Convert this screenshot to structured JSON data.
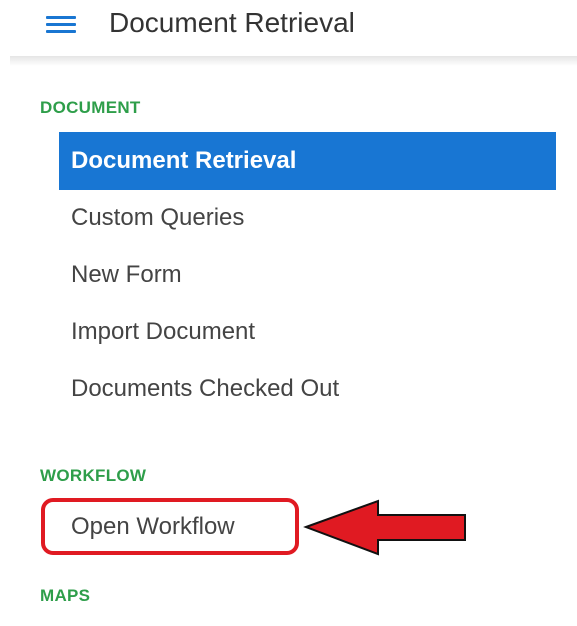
{
  "header": {
    "title": "Document Retrieval",
    "menu_icon": "hamburger-menu-icon"
  },
  "sections": {
    "document": {
      "label": "DOCUMENT",
      "items": [
        {
          "label": "Document Retrieval",
          "active": true
        },
        {
          "label": "Custom Queries",
          "active": false
        },
        {
          "label": "New Form",
          "active": false
        },
        {
          "label": "Import Document",
          "active": false
        },
        {
          "label": "Documents Checked Out",
          "active": false
        }
      ]
    },
    "workflow": {
      "label": "WORKFLOW",
      "items": [
        {
          "label": "Open Workflow",
          "active": false
        }
      ]
    },
    "maps": {
      "label": "MAPS"
    }
  },
  "colors": {
    "accent": "#1876d3",
    "section_label": "#2e9e4a",
    "annotation": "#e01a22"
  },
  "annotation": {
    "highlight_target": "Open Workflow",
    "arrow_icon": "left-arrow-icon"
  }
}
